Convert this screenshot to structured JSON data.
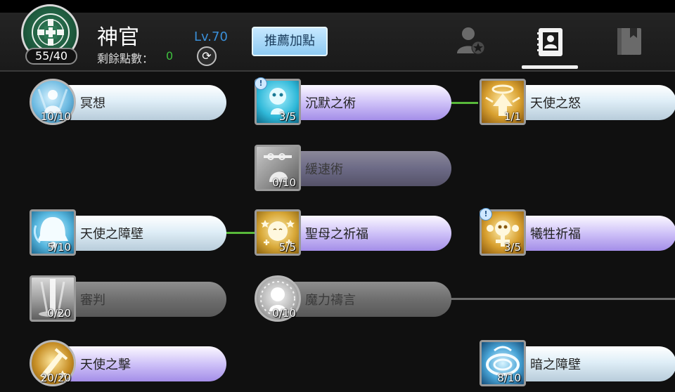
{
  "header": {
    "class_name": "神官",
    "points_badge": "55/40",
    "remaining_label": "剩餘點數：",
    "remaining_value": "0",
    "level": "Lv.70",
    "recommend_label": "推薦加點",
    "reset_glyph": "⟳"
  },
  "tabs": [
    {
      "icon": "character-icon",
      "active": false
    },
    {
      "icon": "skill-book-icon",
      "active": true
    },
    {
      "icon": "bookmark-book-icon",
      "active": false
    }
  ],
  "skills": {
    "meditation": {
      "name": "冥想",
      "level": "10/10",
      "icon": "meditation-icon"
    },
    "silence": {
      "name": "沉默之術",
      "level": "3/5",
      "icon": "silence-icon",
      "info": "!"
    },
    "angel_wrath": {
      "name": "天使之怒",
      "level": "1/1",
      "icon": "angel-wrath-icon"
    },
    "slow": {
      "name": "緩速術",
      "level": "0/10",
      "icon": "slow-icon"
    },
    "angel_barrier": {
      "name": "天使之障壁",
      "level": "5/10",
      "icon": "angel-barrier-icon"
    },
    "mother_blessing": {
      "name": "聖母之祈福",
      "level": "5/5",
      "icon": "mother-blessing-icon"
    },
    "sacrifice_blessing": {
      "name": "犧牲祈福",
      "level": "3/5",
      "icon": "sacrifice-blessing-icon",
      "info": "!"
    },
    "judgment": {
      "name": "審判",
      "level": "0/20",
      "icon": "judgment-icon"
    },
    "magic_oath": {
      "name": "魔力禱言",
      "level": "0/10",
      "icon": "magic-oath-icon"
    },
    "angel_strike": {
      "name": "天使之擊",
      "level": "20/20",
      "icon": "angel-strike-icon"
    },
    "dark_barrier": {
      "name": "暗之障壁",
      "level": "8/10",
      "icon": "dark-barrier-icon"
    }
  },
  "colors": {
    "accent_green": "#58b83a",
    "level_blue": "#3a8fd8",
    "remaining_green": "#3ec03e"
  }
}
